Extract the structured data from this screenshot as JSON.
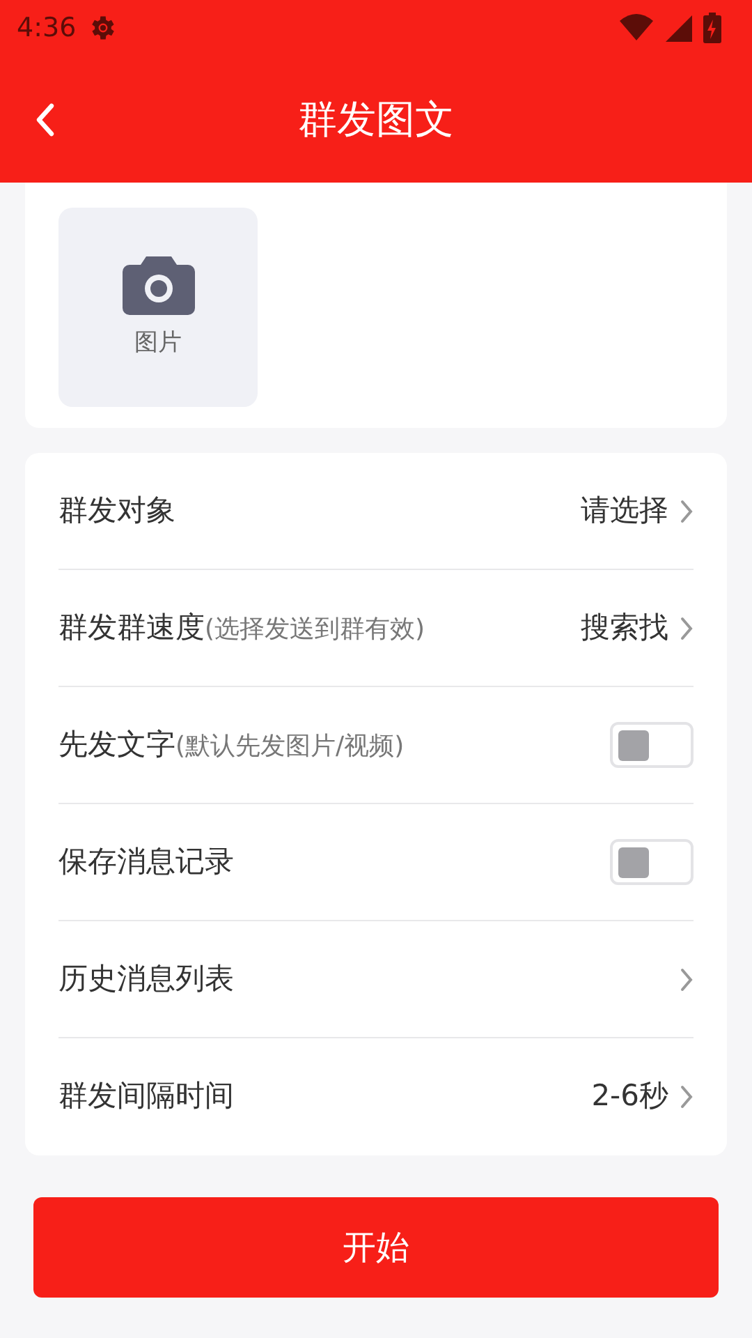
{
  "status_bar": {
    "time": "4:36"
  },
  "header": {
    "title": "群发图文"
  },
  "media": {
    "label": "图片"
  },
  "settings": [
    {
      "kind": "select",
      "label": "群发对象",
      "value": "请选择"
    },
    {
      "kind": "select",
      "label": "群发群速度",
      "hint": "(选择发送到群有效)",
      "value": "搜索找"
    },
    {
      "kind": "toggle",
      "label": "先发文字",
      "hint": "(默认先发图片/视频)",
      "on": false
    },
    {
      "kind": "toggle",
      "label": "保存消息记录",
      "on": false
    },
    {
      "kind": "select",
      "label": "历史消息列表"
    },
    {
      "kind": "select",
      "label": "群发间隔时间",
      "value": "2-6秒"
    }
  ],
  "start_button": "开始"
}
